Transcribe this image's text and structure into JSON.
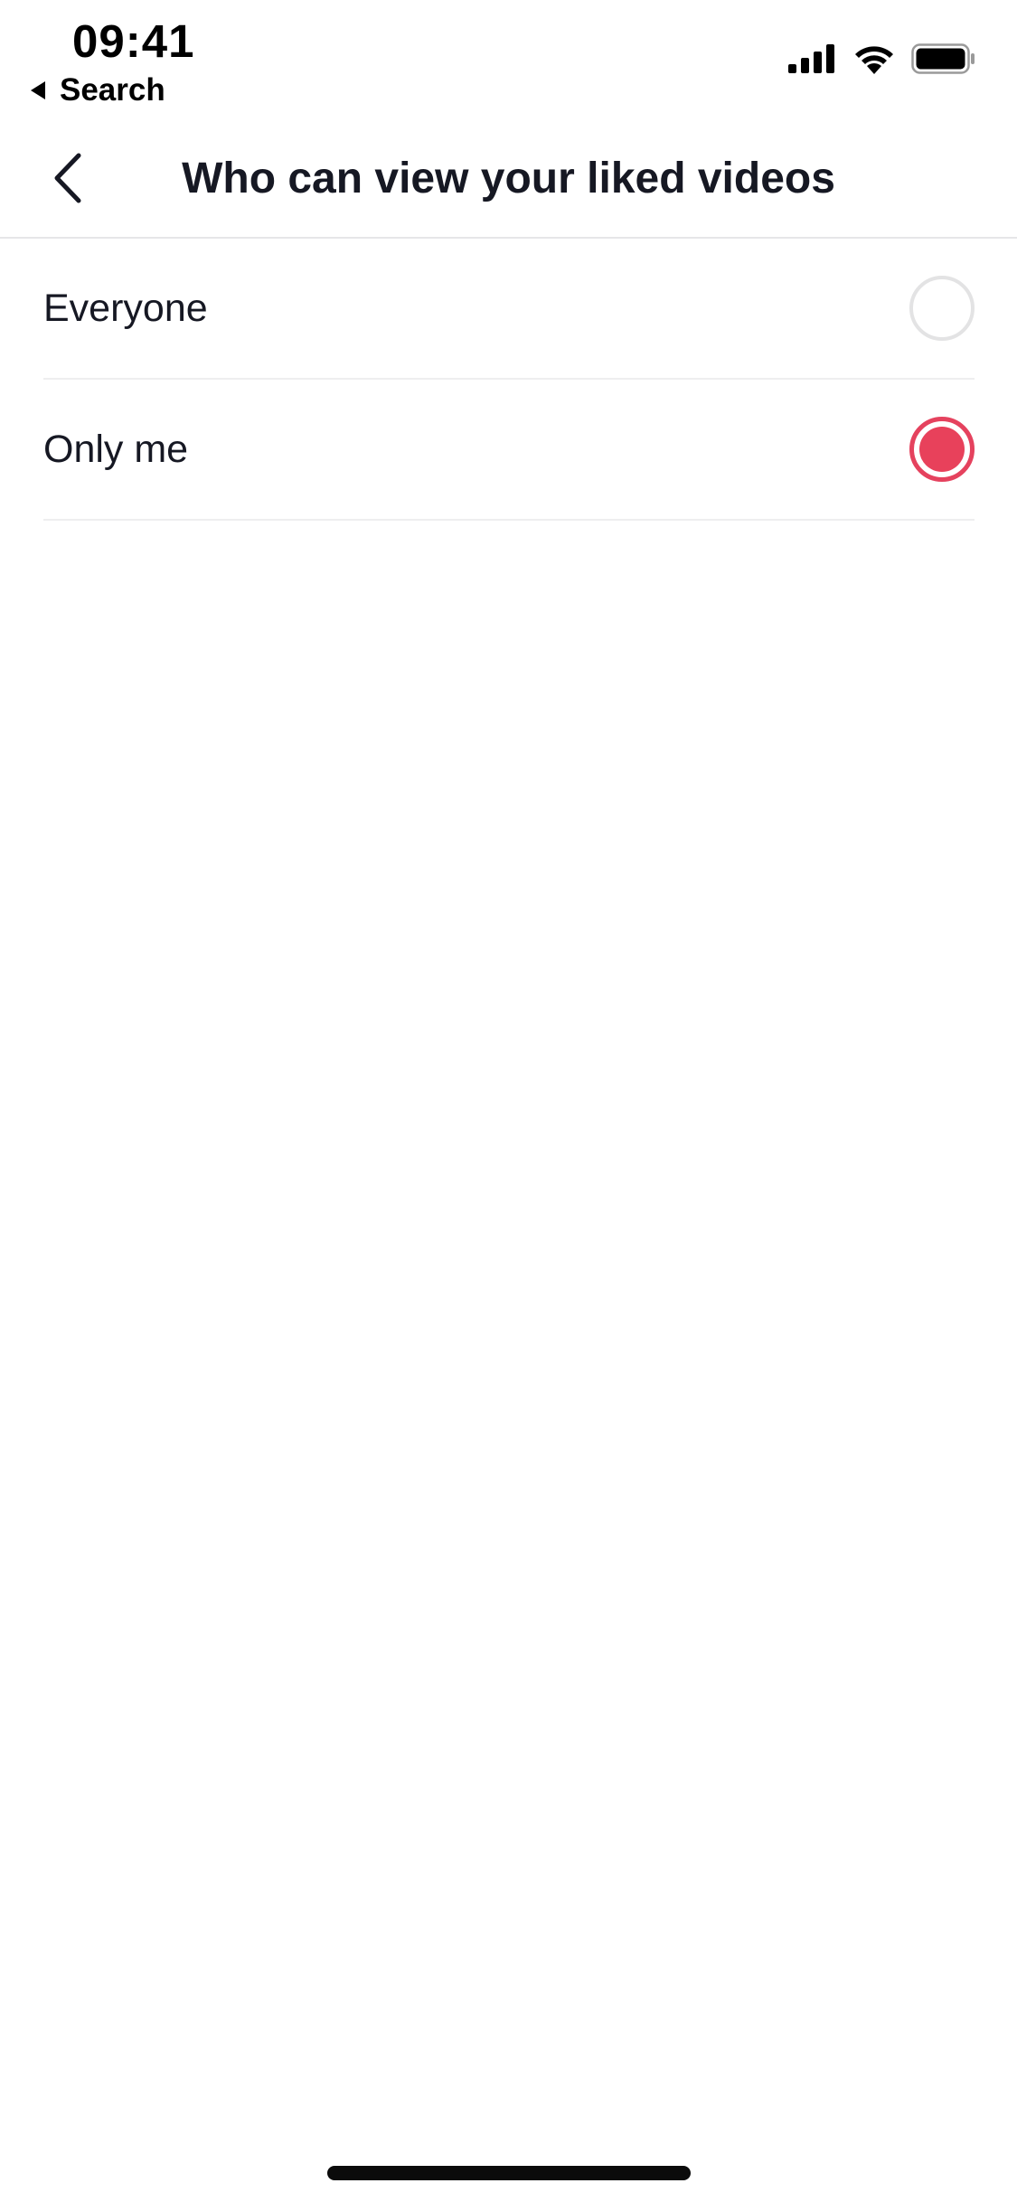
{
  "status_bar": {
    "time": "09:41",
    "back_label": "Search",
    "icons": [
      "cellular-signal-icon",
      "wifi-icon",
      "battery-icon"
    ]
  },
  "nav": {
    "title": "Who can view your liked videos",
    "back_icon": "chevron-left-icon"
  },
  "options": [
    {
      "label": "Everyone",
      "selected": false
    },
    {
      "label": "Only me",
      "selected": true
    }
  ],
  "colors": {
    "accent": "#e8415b",
    "text": "#161823",
    "divider": "#eeeeef",
    "radio_border": "#e3e3e4"
  }
}
